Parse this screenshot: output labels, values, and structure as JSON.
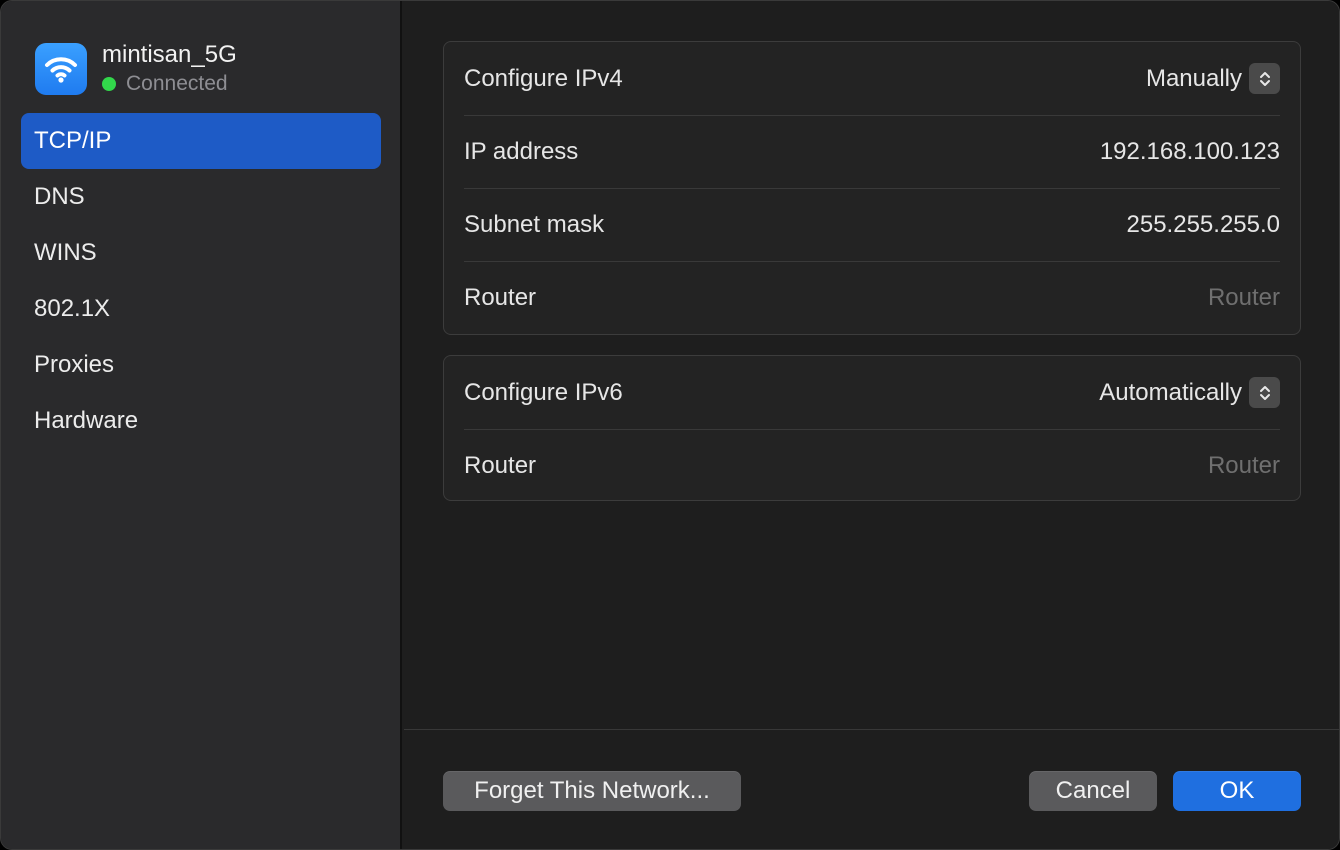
{
  "network": {
    "name": "mintisan_5G",
    "status": "Connected",
    "icon": "wifi-icon",
    "status_color": "#32d74b"
  },
  "sidebar": {
    "items": [
      {
        "label": "TCP/IP",
        "active": true
      },
      {
        "label": "DNS",
        "active": false
      },
      {
        "label": "WINS",
        "active": false
      },
      {
        "label": "802.1X",
        "active": false
      },
      {
        "label": "Proxies",
        "active": false
      },
      {
        "label": "Hardware",
        "active": false
      }
    ]
  },
  "ipv4": {
    "configure_label": "Configure IPv4",
    "configure_value": "Manually",
    "ip_label": "IP address",
    "ip_value": "192.168.100.123",
    "subnet_label": "Subnet mask",
    "subnet_value": "255.255.255.0",
    "router_label": "Router",
    "router_placeholder": "Router"
  },
  "ipv6": {
    "configure_label": "Configure IPv6",
    "configure_value": "Automatically",
    "router_label": "Router",
    "router_value": "Router"
  },
  "footer": {
    "forget_label": "Forget This Network...",
    "cancel_label": "Cancel",
    "ok_label": "OK"
  },
  "colors": {
    "accent": "#1f6fe0",
    "selection": "#1e5bc6"
  }
}
